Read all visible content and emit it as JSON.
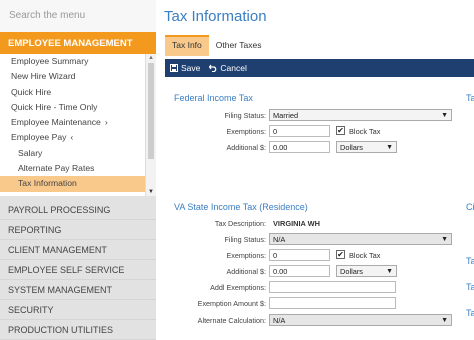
{
  "sidebar": {
    "search_placeholder": "Search the menu",
    "section": "EMPLOYEE MANAGEMENT",
    "items": [
      {
        "label": "Employee Summary"
      },
      {
        "label": "New Hire Wizard"
      },
      {
        "label": "Quick Hire"
      },
      {
        "label": "Quick Hire - Time Only"
      },
      {
        "label": "Employee Maintenance",
        "chevron": "›"
      },
      {
        "label": "Employee Pay",
        "chevron": "‹"
      },
      {
        "label": "Salary"
      },
      {
        "label": "Alternate Pay Rates"
      },
      {
        "label": "Tax Information"
      }
    ],
    "nav": [
      "PAYROLL PROCESSING",
      "REPORTING",
      "CLIENT MANAGEMENT",
      "EMPLOYEE SELF SERVICE",
      "SYSTEM MANAGEMENT",
      "SECURITY",
      "PRODUCTION UTILITIES"
    ]
  },
  "main": {
    "title": "Tax Information",
    "tabs": [
      "Tax Info",
      "Other Taxes"
    ],
    "toolbar": {
      "save": "Save",
      "cancel": "Cancel"
    },
    "federal": {
      "title": "Federal Income Tax",
      "filing_status_label": "Filing Status:",
      "filing_status": "Married",
      "exemptions_label": "Exemptions:",
      "exemptions": "0",
      "block_tax_label": "Block Tax",
      "additional_label": "Additional $:",
      "additional": "0.00",
      "unit": "Dollars"
    },
    "state": {
      "title": "VA State Income Tax (Residence)",
      "tax_description_label": "Tax Description:",
      "tax_description": "VIRGINIA WH",
      "filing_status_label": "Filing Status:",
      "filing_status": "N/A",
      "exemptions_label": "Exemptions:",
      "exemptions": "0",
      "block_tax_label": "Block Tax",
      "additional_label": "Additional $:",
      "additional": "0.00",
      "unit": "Dollars",
      "addl_exemptions_label": "Addl Exemptions:",
      "exemption_amount_label": "Exemption Amount $:",
      "alternate_calc_label": "Alternate Calculation:",
      "alternate_calc": "N/A"
    },
    "right_edge": {
      "t1": "Ta",
      "c1": "Ci",
      "t2": "Ta",
      "t3": "Ta",
      "t4": "Ta"
    }
  },
  "colors": {
    "accent": "#f39a1e",
    "highlight": "#f8c98b",
    "toolbar": "#1f3f70",
    "title": "#3a7fc2"
  }
}
